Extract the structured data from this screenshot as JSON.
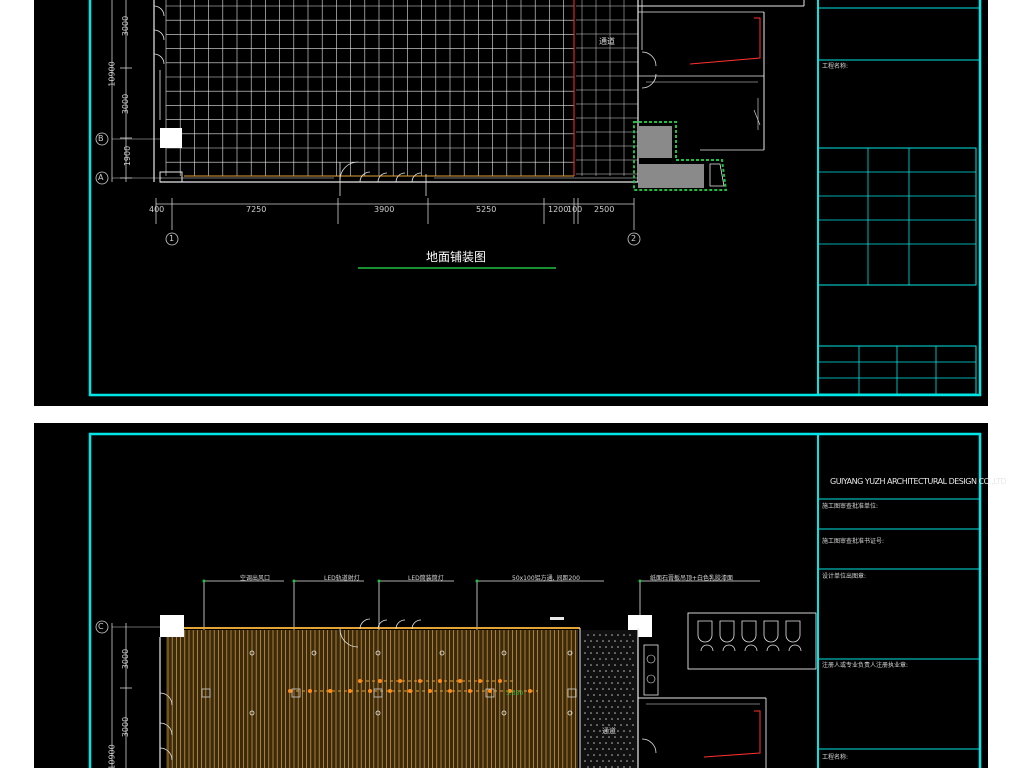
{
  "colors": {
    "frame": "#00e5e5",
    "grid": "#e8e8e8",
    "wall": "#cfcfcf",
    "dimension": "#d0d0d0",
    "wood_floor": "#e3a335",
    "accent_red": "#ff3030",
    "green": "#20c040",
    "yellow": "#ffd23a"
  },
  "sheet_top": {
    "dims_vertical": [
      "3000",
      "10900",
      "3000",
      "1900"
    ],
    "axis_labels": [
      "B",
      "A"
    ],
    "dims_horizontal": [
      "400",
      "7250",
      "3900",
      "5250",
      "1200",
      "100",
      "2500"
    ],
    "grid_labels": [
      "1",
      "2"
    ],
    "corridor_label": "通道",
    "drawing_title": "地面铺装图",
    "title_block": {
      "project_name_label": "工程名称:"
    }
  },
  "sheet_bottom": {
    "company": "GUIYANG YUZH ARCHITECTURAL DESIGN CO.,LTD",
    "title_block": {
      "row1": "施工图审查批准单位:",
      "row2": "施工图审查批准书证号:",
      "row3": "设计单位出图章:",
      "row4": "注册人或专业负责人注册执业章:",
      "row5": "工程名称:"
    },
    "annotations": [
      "空调出风口",
      "LED轨道射灯",
      "LED筒装筒灯",
      "50x100铝方通, 间距200",
      "纸面石膏板吊顶+白色乳胶漆面"
    ],
    "axis_label": "C",
    "dims_vertical": [
      "3000",
      "3000",
      "10900"
    ],
    "level_mark": "3.550",
    "corridor_label": "通道"
  }
}
